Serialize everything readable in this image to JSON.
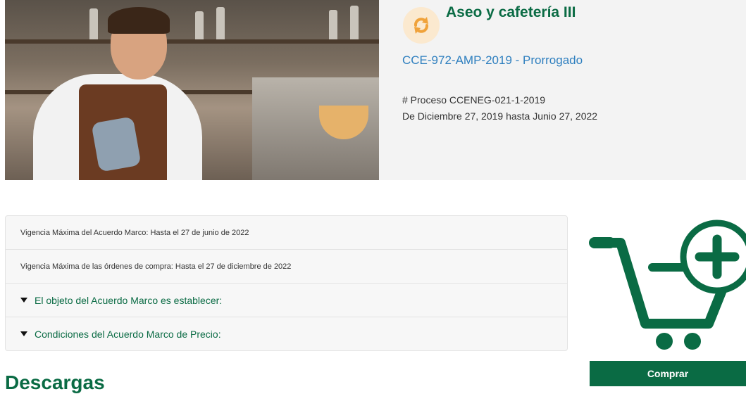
{
  "header": {
    "title": "Aseo y cafetería III",
    "code": "CCE-972-AMP-2019 - Prorrogado",
    "process": "# Proceso CCENEG-021-1-2019",
    "dates": "De Diciembre 27, 2019 hasta Junio 27, 2022",
    "status_icon": "refresh-icon",
    "hero_image": "barista-photo"
  },
  "details": {
    "rows": [
      "Vigencia Máxima del Acuerdo Marco: Hasta el 27 de junio de 2022",
      "Vigencia Máxima de las órdenes de compra: Hasta el 27 de diciembre de 2022"
    ],
    "toggles": [
      "El objeto del Acuerdo Marco es establecer:",
      "Condiciones del Acuerdo Marco de Precio:"
    ]
  },
  "downloads": {
    "heading": "Descargas"
  },
  "cart": {
    "icon": "add-to-cart-icon",
    "button_label": "Comprar"
  },
  "colors": {
    "brand_green": "#0a6b44",
    "link_blue": "#2e7fbf",
    "icon_orange": "#f0a23a"
  }
}
